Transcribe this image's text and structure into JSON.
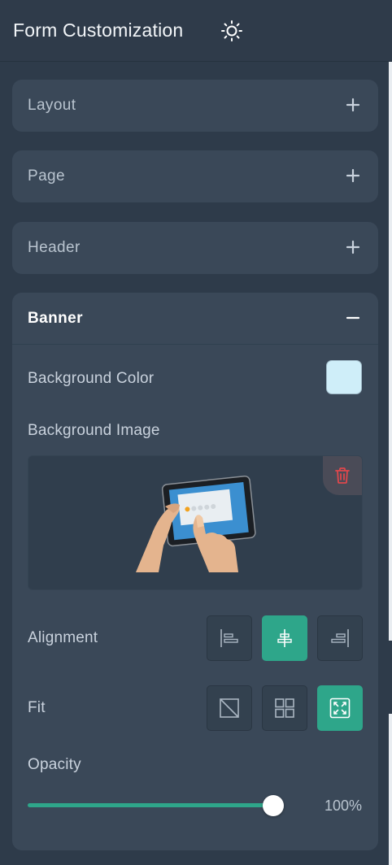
{
  "header": {
    "title": "Form Customization",
    "theme_icon": "sun-icon"
  },
  "panels": {
    "layout": {
      "label": "Layout",
      "toggle": "+"
    },
    "page": {
      "label": "Page",
      "toggle": "+"
    },
    "header": {
      "label": "Header",
      "toggle": "+"
    },
    "banner": {
      "label": "Banner",
      "toggle": "−",
      "background_color_label": "Background Color",
      "background_color_value": "#cfeef9",
      "background_image_label": "Background Image",
      "alignment_label": "Alignment",
      "alignment_options": [
        "left",
        "center",
        "right"
      ],
      "alignment_selected": "center",
      "fit_label": "Fit",
      "fit_options": [
        "none",
        "tile",
        "stretch"
      ],
      "fit_selected": "stretch",
      "opacity_label": "Opacity",
      "opacity_value": "100%",
      "opacity_fraction": 1.0
    }
  },
  "colors": {
    "accent": "#2ea68a",
    "background": "#2e3b4a",
    "panel": "#3a4858",
    "delete": "#e0474c"
  }
}
